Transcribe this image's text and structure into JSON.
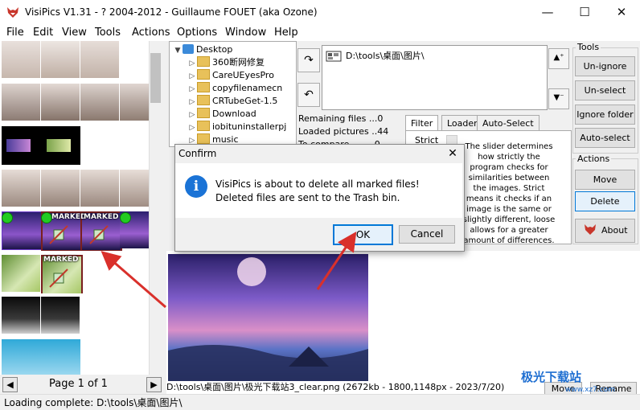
{
  "window": {
    "title": "VisiPics V1.31 - ? 2004-2012 - Guillaume FOUET (aka Ozone)",
    "minimize": "—",
    "maximize": "☐",
    "close": "✕"
  },
  "menu": [
    "File",
    "Edit",
    "View",
    "Tools",
    "Actions",
    "Options",
    "Window",
    "Help"
  ],
  "thumbnails": {
    "marked_label": "MARKED",
    "page_label": "Page 1 of 1",
    "prev_icon": "arrow-left-icon",
    "next_icon": "arrow-right-icon"
  },
  "tree": {
    "root": "Desktop",
    "items": [
      "360断网修复",
      "CareUEyesPro",
      "copyfilenamecn",
      "CRTubeGet-1.5",
      "Download",
      "iobituninstallerpj",
      "music"
    ]
  },
  "path_list": {
    "items": [
      "D:\\tools\\桌面\\图片\\"
    ]
  },
  "stats": {
    "remaining": "Remaining files ...0",
    "loaded": "Loaded pictures ..44",
    "to_compare": "To compare ........0"
  },
  "tabs": [
    "Filter",
    "Loader",
    "Auto-Select"
  ],
  "filter": {
    "strict_label": "Strict",
    "description": "The slider determines how strictly the program checks for similarities between the images. Strict means it checks if an image is the same or slightly different, loose allows for a greater amount of differences."
  },
  "tools": {
    "title": "Tools",
    "buttons": [
      "Un-ignore",
      "Un-select",
      "Ignore folder",
      "Auto-select"
    ]
  },
  "actions": {
    "title": "Actions",
    "move": "Move",
    "delete": "Delete",
    "about": "About"
  },
  "preview": {
    "info": "D:\\tools\\桌面\\图片\\极光下载站3_clear.png (2672kb - 1800,1148px - 2023/7/20)",
    "move": "Move",
    "rename": "Rename"
  },
  "status": "Loading complete: D:\\tools\\桌面\\图片\\",
  "dialog": {
    "title": "Confirm",
    "line1": "VisiPics is about to delete all marked files!",
    "line2": "Deleted files are sent to the Trash bin.",
    "ok": "OK",
    "cancel": "Cancel",
    "close": "✕"
  },
  "watermark": {
    "name": "极光下载站",
    "url": "www.xz7.com"
  },
  "colors": {
    "accent": "#0078d7",
    "annotation_arrow": "#d9302b",
    "info_icon": "#1a73d6",
    "marked_dot": "#22cc22"
  }
}
